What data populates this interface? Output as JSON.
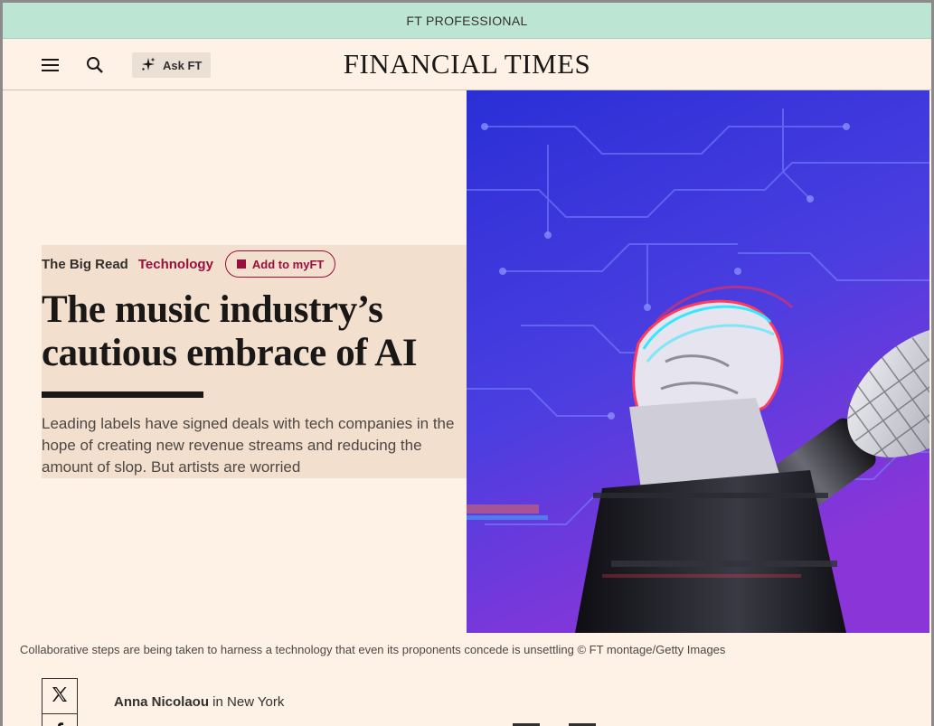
{
  "banner": {
    "label": "FT PROFESSIONAL"
  },
  "header": {
    "menu_icon": "hamburger-menu-icon",
    "search_icon": "search-icon",
    "askft_icon": "sparkle-icon",
    "askft_label": "Ask FT",
    "logo": "FINANCIAL TIMES"
  },
  "article": {
    "section_tag": "The Big Read",
    "topic_tag": "Technology",
    "myft_label": "Add to myFT",
    "headline": "The music industry’s cautious embrace of AI",
    "standfirst": "Leading labels have signed deals with tech companies in the hope of creating new revenue streams and reducing the amount of slop. But artists are worried",
    "image_caption": "Collaborative steps are being taken to harness a technology that even its proponents concede is unsettling © FT montage/Getty Images",
    "author": "Anna Nicolaou",
    "location_text": " in New York"
  },
  "share": {
    "x_icon": "x-logo-icon",
    "facebook_icon": "facebook-icon"
  },
  "colors": {
    "paper": "#fef1e5",
    "banner": "#bde5d4",
    "claret": "#990f3d",
    "ink": "#1a1817"
  }
}
